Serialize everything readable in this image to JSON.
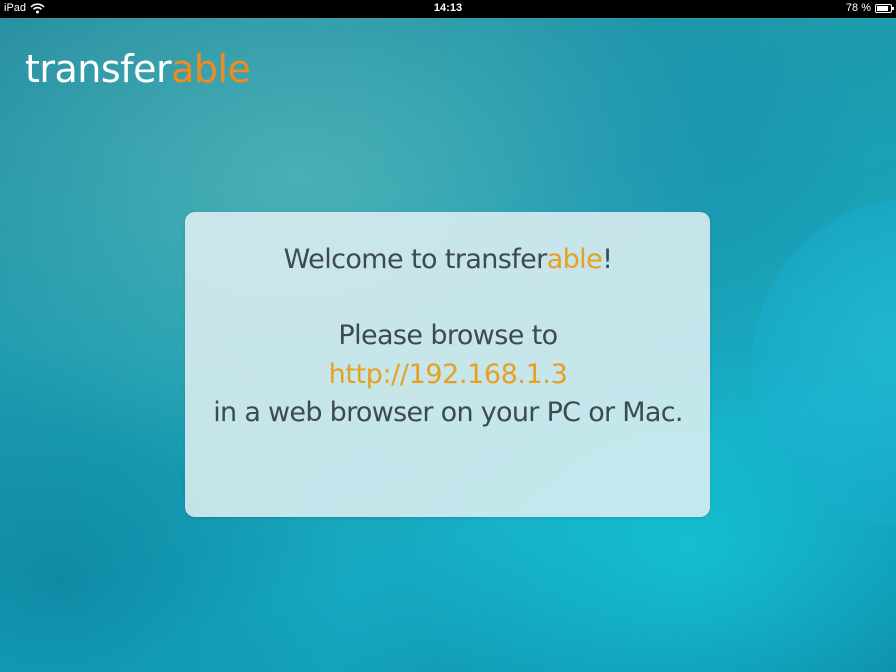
{
  "status_bar": {
    "device": "iPad",
    "time": "14:13",
    "battery": "78 %"
  },
  "logo": {
    "part1": "transfer",
    "part2": "able"
  },
  "welcome": {
    "prefix": "Welcome to transfer",
    "accent": "able",
    "suffix": "!"
  },
  "instructions": {
    "line1": "Please browse to",
    "url": "http://192.168.1.3",
    "line3": "in a web browser on your PC or Mac."
  },
  "colors": {
    "accent_orange": "#f08c1e",
    "url_yellow": "#e8a020",
    "text_dark": "#3d4a52",
    "background_teal": "#17aac2"
  },
  "icons": {
    "wifi": "wifi-icon",
    "battery": "battery-icon"
  }
}
